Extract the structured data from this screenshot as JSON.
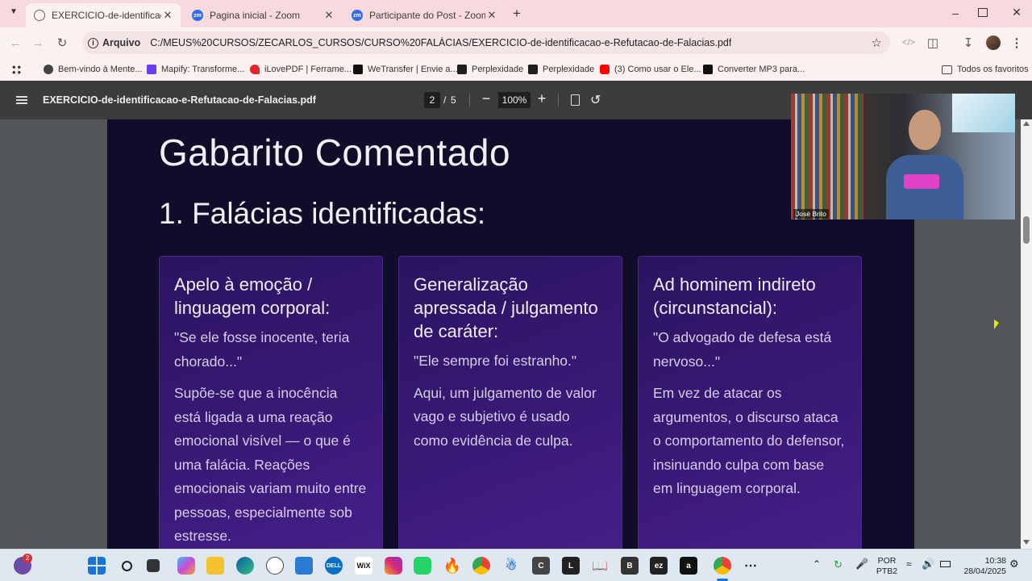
{
  "tabs": [
    {
      "title": "EXERCICIO-de-identificacao-e-R",
      "active": true
    },
    {
      "title": "Pagina inicial - Zoom",
      "active": false
    },
    {
      "title": "Participante do Post - Zoom",
      "active": false
    }
  ],
  "omnibox": {
    "scheme_label": "Arquivo",
    "url": "C:/MEUS%20CURSOS/ZECARLOS_CURSOS/CURSO%20FALÁCIAS/EXERCICIO-de-identificacao-e-Refutacao-de-Falacias.pdf"
  },
  "bookmarks": [
    {
      "label": "Bem-vindo à Mente...",
      "color": "#444444"
    },
    {
      "label": "Mapify: Transforme...",
      "color": "#6a3df0"
    },
    {
      "label": "iLovePDF | Ferrame...",
      "color": "#e3242b"
    },
    {
      "label": "WeTransfer | Envie a...",
      "color": "#111111"
    },
    {
      "label": "Perplexidade",
      "color": "#1f1f1f"
    },
    {
      "label": "Perplexidade",
      "color": "#1f1f1f"
    },
    {
      "label": "(3) Como usar o Ele...",
      "color": "#ff0000"
    },
    {
      "label": "Converter MP3 para...",
      "color": "#111111"
    }
  ],
  "bookmarks_all": "Todos os favoritos",
  "pdf": {
    "filename": "EXERCICIO-de-identificacao-e-Refutacao-de-Falacias.pdf",
    "current_page": "2",
    "separator": "/",
    "total_pages": "5",
    "zoom": "100%"
  },
  "document": {
    "title": "Gabarito Comentado",
    "section": "1. Falácias identificadas:",
    "cards": [
      {
        "title": "Apelo à emoção / linguagem corporal:",
        "quote": "\"Se ele fosse inocente, teria chorado...\"",
        "body": "Supõe-se que a inocência está ligada a uma reação emocional visível — o que é uma falácia. Reações emocionais variam muito entre pessoas, especialmente sob estresse."
      },
      {
        "title": "Generalização apressada / julgamento de caráter:",
        "quote": "\"Ele sempre foi estranho.\"",
        "body": "Aqui, um julgamento de valor vago e subjetivo é usado como evidência de culpa."
      },
      {
        "title": "Ad hominem indireto (circunstancial):",
        "quote": "\"O advogado de defesa está nervoso...\"",
        "body": "Em vez de atacar os argumentos, o discurso ataca o comportamento do defensor, insinuando culpa com base em linguagem corporal."
      }
    ]
  },
  "video": {
    "participant_name": "José Brito"
  },
  "taskbar": {
    "badge_count": "2",
    "language": "POR",
    "layout": "PTB2",
    "time": "10:38",
    "date": "28/04/2025"
  },
  "colors": {
    "accent": "#2d6cf0",
    "page_bg": "#100c2a",
    "card": "#3a1a78"
  }
}
